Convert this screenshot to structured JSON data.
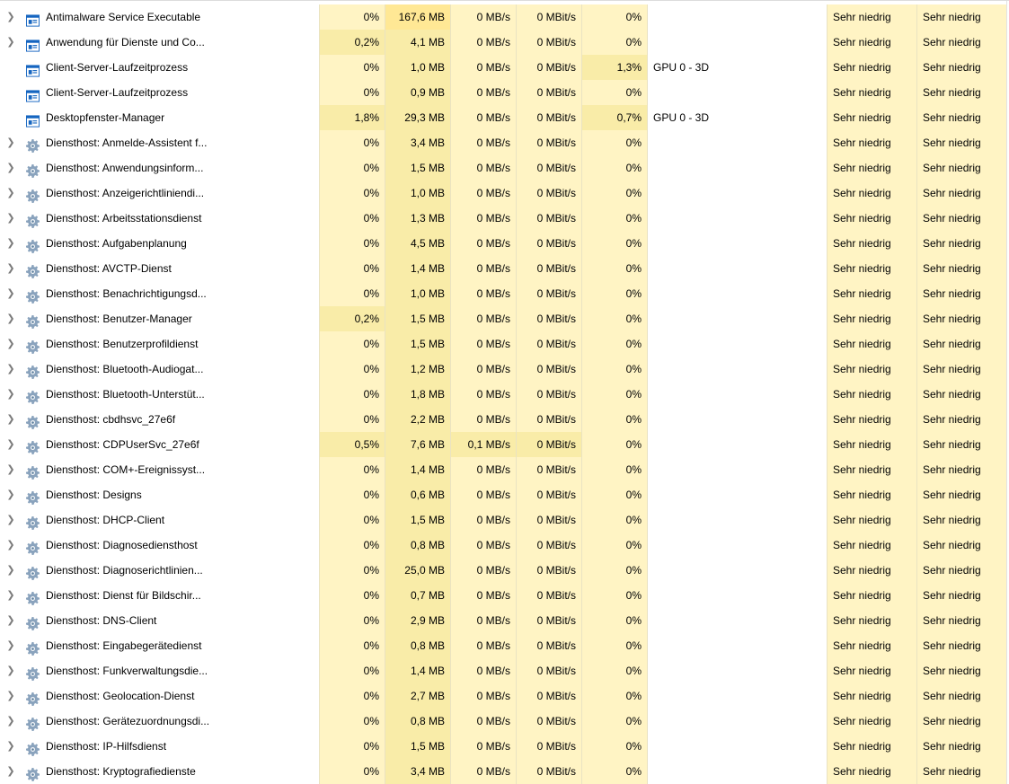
{
  "colors": {
    "heat_0": "#fff4c4",
    "heat_1": "#f9eca8",
    "heat_2": "#ffe895",
    "accent_icon": "#1565c0"
  },
  "processes": [
    {
      "name": "Antimalware Service Executable",
      "expandable": true,
      "icon": "app-window-icon",
      "cpu": "0%",
      "memory": "167,6 MB",
      "disk": "0 MB/s",
      "network": "0 MBit/s",
      "gpu": "0%",
      "gpu_engine": "",
      "power": "Sehr niedrig",
      "power_trend": "Sehr niedrig",
      "heat": {
        "cpu": 0,
        "mem": 2,
        "disk": 0,
        "net": 0,
        "gpu": 0
      }
    },
    {
      "name": "Anwendung für Dienste und Co...",
      "expandable": true,
      "icon": "app-window-icon",
      "cpu": "0,2%",
      "memory": "4,1 MB",
      "disk": "0 MB/s",
      "network": "0 MBit/s",
      "gpu": "0%",
      "gpu_engine": "",
      "power": "Sehr niedrig",
      "power_trend": "Sehr niedrig",
      "heat": {
        "cpu": 1,
        "mem": 1,
        "disk": 0,
        "net": 0,
        "gpu": 0
      }
    },
    {
      "name": "Client-Server-Laufzeitprozess",
      "expandable": false,
      "icon": "app-window-icon",
      "cpu": "0%",
      "memory": "1,0 MB",
      "disk": "0 MB/s",
      "network": "0 MBit/s",
      "gpu": "1,3%",
      "gpu_engine": "GPU 0 - 3D",
      "power": "Sehr niedrig",
      "power_trend": "Sehr niedrig",
      "heat": {
        "cpu": 0,
        "mem": 1,
        "disk": 0,
        "net": 0,
        "gpu": 1
      }
    },
    {
      "name": "Client-Server-Laufzeitprozess",
      "expandable": false,
      "icon": "app-window-icon",
      "cpu": "0%",
      "memory": "0,9 MB",
      "disk": "0 MB/s",
      "network": "0 MBit/s",
      "gpu": "0%",
      "gpu_engine": "",
      "power": "Sehr niedrig",
      "power_trend": "Sehr niedrig",
      "heat": {
        "cpu": 0,
        "mem": 1,
        "disk": 0,
        "net": 0,
        "gpu": 0
      }
    },
    {
      "name": "Desktopfenster-Manager",
      "expandable": false,
      "icon": "app-window-icon",
      "cpu": "1,8%",
      "memory": "29,3 MB",
      "disk": "0 MB/s",
      "network": "0 MBit/s",
      "gpu": "0,7%",
      "gpu_engine": "GPU 0 - 3D",
      "power": "Sehr niedrig",
      "power_trend": "Sehr niedrig",
      "heat": {
        "cpu": 1,
        "mem": 1,
        "disk": 0,
        "net": 0,
        "gpu": 1
      }
    },
    {
      "name": "Diensthost: Anmelde-Assistent f...",
      "expandable": true,
      "icon": "gear-icon",
      "cpu": "0%",
      "memory": "3,4 MB",
      "disk": "0 MB/s",
      "network": "0 MBit/s",
      "gpu": "0%",
      "gpu_engine": "",
      "power": "Sehr niedrig",
      "power_trend": "Sehr niedrig",
      "heat": {
        "cpu": 0,
        "mem": 1,
        "disk": 0,
        "net": 0,
        "gpu": 0
      }
    },
    {
      "name": "Diensthost: Anwendungsinform...",
      "expandable": true,
      "icon": "gear-icon",
      "cpu": "0%",
      "memory": "1,5 MB",
      "disk": "0 MB/s",
      "network": "0 MBit/s",
      "gpu": "0%",
      "gpu_engine": "",
      "power": "Sehr niedrig",
      "power_trend": "Sehr niedrig",
      "heat": {
        "cpu": 0,
        "mem": 1,
        "disk": 0,
        "net": 0,
        "gpu": 0
      }
    },
    {
      "name": "Diensthost: Anzeigerichtliniendi...",
      "expandable": true,
      "icon": "gear-icon",
      "cpu": "0%",
      "memory": "1,0 MB",
      "disk": "0 MB/s",
      "network": "0 MBit/s",
      "gpu": "0%",
      "gpu_engine": "",
      "power": "Sehr niedrig",
      "power_trend": "Sehr niedrig",
      "heat": {
        "cpu": 0,
        "mem": 1,
        "disk": 0,
        "net": 0,
        "gpu": 0
      }
    },
    {
      "name": "Diensthost: Arbeitsstationsdienst",
      "expandable": true,
      "icon": "gear-icon",
      "cpu": "0%",
      "memory": "1,3 MB",
      "disk": "0 MB/s",
      "network": "0 MBit/s",
      "gpu": "0%",
      "gpu_engine": "",
      "power": "Sehr niedrig",
      "power_trend": "Sehr niedrig",
      "heat": {
        "cpu": 0,
        "mem": 1,
        "disk": 0,
        "net": 0,
        "gpu": 0
      }
    },
    {
      "name": "Diensthost: Aufgabenplanung",
      "expandable": true,
      "icon": "gear-icon",
      "cpu": "0%",
      "memory": "4,5 MB",
      "disk": "0 MB/s",
      "network": "0 MBit/s",
      "gpu": "0%",
      "gpu_engine": "",
      "power": "Sehr niedrig",
      "power_trend": "Sehr niedrig",
      "heat": {
        "cpu": 0,
        "mem": 1,
        "disk": 0,
        "net": 0,
        "gpu": 0
      }
    },
    {
      "name": "Diensthost: AVCTP-Dienst",
      "expandable": true,
      "icon": "gear-icon",
      "cpu": "0%",
      "memory": "1,4 MB",
      "disk": "0 MB/s",
      "network": "0 MBit/s",
      "gpu": "0%",
      "gpu_engine": "",
      "power": "Sehr niedrig",
      "power_trend": "Sehr niedrig",
      "heat": {
        "cpu": 0,
        "mem": 1,
        "disk": 0,
        "net": 0,
        "gpu": 0
      }
    },
    {
      "name": "Diensthost: Benachrichtigungsd...",
      "expandable": true,
      "icon": "gear-icon",
      "cpu": "0%",
      "memory": "1,0 MB",
      "disk": "0 MB/s",
      "network": "0 MBit/s",
      "gpu": "0%",
      "gpu_engine": "",
      "power": "Sehr niedrig",
      "power_trend": "Sehr niedrig",
      "heat": {
        "cpu": 0,
        "mem": 1,
        "disk": 0,
        "net": 0,
        "gpu": 0
      }
    },
    {
      "name": "Diensthost: Benutzer-Manager",
      "expandable": true,
      "icon": "gear-icon",
      "cpu": "0,2%",
      "memory": "1,5 MB",
      "disk": "0 MB/s",
      "network": "0 MBit/s",
      "gpu": "0%",
      "gpu_engine": "",
      "power": "Sehr niedrig",
      "power_trend": "Sehr niedrig",
      "heat": {
        "cpu": 1,
        "mem": 1,
        "disk": 0,
        "net": 0,
        "gpu": 0
      }
    },
    {
      "name": "Diensthost: Benutzerprofildienst",
      "expandable": true,
      "icon": "gear-icon",
      "cpu": "0%",
      "memory": "1,5 MB",
      "disk": "0 MB/s",
      "network": "0 MBit/s",
      "gpu": "0%",
      "gpu_engine": "",
      "power": "Sehr niedrig",
      "power_trend": "Sehr niedrig",
      "heat": {
        "cpu": 0,
        "mem": 1,
        "disk": 0,
        "net": 0,
        "gpu": 0
      }
    },
    {
      "name": "Diensthost: Bluetooth-Audiogat...",
      "expandable": true,
      "icon": "gear-icon",
      "cpu": "0%",
      "memory": "1,2 MB",
      "disk": "0 MB/s",
      "network": "0 MBit/s",
      "gpu": "0%",
      "gpu_engine": "",
      "power": "Sehr niedrig",
      "power_trend": "Sehr niedrig",
      "heat": {
        "cpu": 0,
        "mem": 1,
        "disk": 0,
        "net": 0,
        "gpu": 0
      }
    },
    {
      "name": "Diensthost: Bluetooth-Unterstüt...",
      "expandable": true,
      "icon": "gear-icon",
      "cpu": "0%",
      "memory": "1,8 MB",
      "disk": "0 MB/s",
      "network": "0 MBit/s",
      "gpu": "0%",
      "gpu_engine": "",
      "power": "Sehr niedrig",
      "power_trend": "Sehr niedrig",
      "heat": {
        "cpu": 0,
        "mem": 1,
        "disk": 0,
        "net": 0,
        "gpu": 0
      }
    },
    {
      "name": "Diensthost: cbdhsvc_27e6f",
      "expandable": true,
      "icon": "gear-icon",
      "cpu": "0%",
      "memory": "2,2 MB",
      "disk": "0 MB/s",
      "network": "0 MBit/s",
      "gpu": "0%",
      "gpu_engine": "",
      "power": "Sehr niedrig",
      "power_trend": "Sehr niedrig",
      "heat": {
        "cpu": 0,
        "mem": 1,
        "disk": 0,
        "net": 0,
        "gpu": 0
      }
    },
    {
      "name": "Diensthost: CDPUserSvc_27e6f",
      "expandable": true,
      "icon": "gear-icon",
      "cpu": "0,5%",
      "memory": "7,6 MB",
      "disk": "0,1 MB/s",
      "network": "0 MBit/s",
      "gpu": "0%",
      "gpu_engine": "",
      "power": "Sehr niedrig",
      "power_trend": "Sehr niedrig",
      "heat": {
        "cpu": 1,
        "mem": 1,
        "disk": 1,
        "net": 1,
        "gpu": 0
      }
    },
    {
      "name": "Diensthost: COM+-Ereignissyst...",
      "expandable": true,
      "icon": "gear-icon",
      "cpu": "0%",
      "memory": "1,4 MB",
      "disk": "0 MB/s",
      "network": "0 MBit/s",
      "gpu": "0%",
      "gpu_engine": "",
      "power": "Sehr niedrig",
      "power_trend": "Sehr niedrig",
      "heat": {
        "cpu": 0,
        "mem": 1,
        "disk": 0,
        "net": 0,
        "gpu": 0
      }
    },
    {
      "name": "Diensthost: Designs",
      "expandable": true,
      "icon": "gear-icon",
      "cpu": "0%",
      "memory": "0,6 MB",
      "disk": "0 MB/s",
      "network": "0 MBit/s",
      "gpu": "0%",
      "gpu_engine": "",
      "power": "Sehr niedrig",
      "power_trend": "Sehr niedrig",
      "heat": {
        "cpu": 0,
        "mem": 1,
        "disk": 0,
        "net": 0,
        "gpu": 0
      }
    },
    {
      "name": "Diensthost: DHCP-Client",
      "expandable": true,
      "icon": "gear-icon",
      "cpu": "0%",
      "memory": "1,5 MB",
      "disk": "0 MB/s",
      "network": "0 MBit/s",
      "gpu": "0%",
      "gpu_engine": "",
      "power": "Sehr niedrig",
      "power_trend": "Sehr niedrig",
      "heat": {
        "cpu": 0,
        "mem": 1,
        "disk": 0,
        "net": 0,
        "gpu": 0
      }
    },
    {
      "name": "Diensthost: Diagnosediensthost",
      "expandable": true,
      "icon": "gear-icon",
      "cpu": "0%",
      "memory": "0,8 MB",
      "disk": "0 MB/s",
      "network": "0 MBit/s",
      "gpu": "0%",
      "gpu_engine": "",
      "power": "Sehr niedrig",
      "power_trend": "Sehr niedrig",
      "heat": {
        "cpu": 0,
        "mem": 1,
        "disk": 0,
        "net": 0,
        "gpu": 0
      }
    },
    {
      "name": "Diensthost: Diagnoserichtlinien...",
      "expandable": true,
      "icon": "gear-icon",
      "cpu": "0%",
      "memory": "25,0 MB",
      "disk": "0 MB/s",
      "network": "0 MBit/s",
      "gpu": "0%",
      "gpu_engine": "",
      "power": "Sehr niedrig",
      "power_trend": "Sehr niedrig",
      "heat": {
        "cpu": 0,
        "mem": 1,
        "disk": 0,
        "net": 0,
        "gpu": 0
      }
    },
    {
      "name": "Diensthost: Dienst für Bildschir...",
      "expandable": true,
      "icon": "gear-icon",
      "cpu": "0%",
      "memory": "0,7 MB",
      "disk": "0 MB/s",
      "network": "0 MBit/s",
      "gpu": "0%",
      "gpu_engine": "",
      "power": "Sehr niedrig",
      "power_trend": "Sehr niedrig",
      "heat": {
        "cpu": 0,
        "mem": 1,
        "disk": 0,
        "net": 0,
        "gpu": 0
      }
    },
    {
      "name": "Diensthost: DNS-Client",
      "expandable": true,
      "icon": "gear-icon",
      "cpu": "0%",
      "memory": "2,9 MB",
      "disk": "0 MB/s",
      "network": "0 MBit/s",
      "gpu": "0%",
      "gpu_engine": "",
      "power": "Sehr niedrig",
      "power_trend": "Sehr niedrig",
      "heat": {
        "cpu": 0,
        "mem": 1,
        "disk": 0,
        "net": 0,
        "gpu": 0
      }
    },
    {
      "name": "Diensthost: Eingabegerätedienst",
      "expandable": true,
      "icon": "gear-icon",
      "cpu": "0%",
      "memory": "0,8 MB",
      "disk": "0 MB/s",
      "network": "0 MBit/s",
      "gpu": "0%",
      "gpu_engine": "",
      "power": "Sehr niedrig",
      "power_trend": "Sehr niedrig",
      "heat": {
        "cpu": 0,
        "mem": 1,
        "disk": 0,
        "net": 0,
        "gpu": 0
      }
    },
    {
      "name": "Diensthost: Funkverwaltungsdie...",
      "expandable": true,
      "icon": "gear-icon",
      "cpu": "0%",
      "memory": "1,4 MB",
      "disk": "0 MB/s",
      "network": "0 MBit/s",
      "gpu": "0%",
      "gpu_engine": "",
      "power": "Sehr niedrig",
      "power_trend": "Sehr niedrig",
      "heat": {
        "cpu": 0,
        "mem": 1,
        "disk": 0,
        "net": 0,
        "gpu": 0
      }
    },
    {
      "name": "Diensthost: Geolocation-Dienst",
      "expandable": true,
      "icon": "gear-icon",
      "cpu": "0%",
      "memory": "2,7 MB",
      "disk": "0 MB/s",
      "network": "0 MBit/s",
      "gpu": "0%",
      "gpu_engine": "",
      "power": "Sehr niedrig",
      "power_trend": "Sehr niedrig",
      "heat": {
        "cpu": 0,
        "mem": 1,
        "disk": 0,
        "net": 0,
        "gpu": 0
      }
    },
    {
      "name": "Diensthost: Gerätezuordnungsdi...",
      "expandable": true,
      "icon": "gear-icon",
      "cpu": "0%",
      "memory": "0,8 MB",
      "disk": "0 MB/s",
      "network": "0 MBit/s",
      "gpu": "0%",
      "gpu_engine": "",
      "power": "Sehr niedrig",
      "power_trend": "Sehr niedrig",
      "heat": {
        "cpu": 0,
        "mem": 1,
        "disk": 0,
        "net": 0,
        "gpu": 0
      }
    },
    {
      "name": "Diensthost: IP-Hilfsdienst",
      "expandable": true,
      "icon": "gear-icon",
      "cpu": "0%",
      "memory": "1,5 MB",
      "disk": "0 MB/s",
      "network": "0 MBit/s",
      "gpu": "0%",
      "gpu_engine": "",
      "power": "Sehr niedrig",
      "power_trend": "Sehr niedrig",
      "heat": {
        "cpu": 0,
        "mem": 1,
        "disk": 0,
        "net": 0,
        "gpu": 0
      }
    },
    {
      "name": "Diensthost: Kryptografiedienste",
      "expandable": true,
      "icon": "gear-icon",
      "cpu": "0%",
      "memory": "3,4 MB",
      "disk": "0 MB/s",
      "network": "0 MBit/s",
      "gpu": "0%",
      "gpu_engine": "",
      "power": "Sehr niedrig",
      "power_trend": "Sehr niedrig",
      "heat": {
        "cpu": 0,
        "mem": 1,
        "disk": 0,
        "net": 0,
        "gpu": 0
      }
    }
  ]
}
